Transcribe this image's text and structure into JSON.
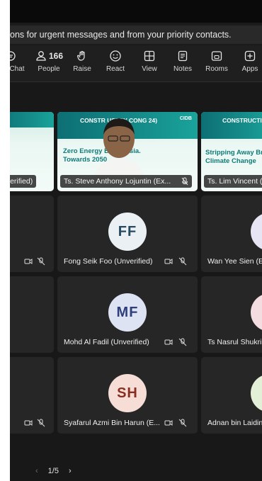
{
  "banner": {
    "text": "ons for urgent messages and from your priority contacts."
  },
  "toolbar": {
    "items": [
      {
        "label": "Chat",
        "icon": "chat-icon"
      },
      {
        "label": "People",
        "icon": "people-icon",
        "count": "166"
      },
      {
        "label": "Raise",
        "icon": "raise-hand-icon"
      },
      {
        "label": "React",
        "icon": "react-icon"
      },
      {
        "label": "View",
        "icon": "view-icon"
      },
      {
        "label": "Notes",
        "icon": "notes-icon"
      },
      {
        "label": "Rooms",
        "icon": "rooms-icon"
      },
      {
        "label": "Apps",
        "icon": "apps-icon"
      }
    ]
  },
  "stage": {
    "top_row": [
      {
        "name": "nverified)",
        "slide_text": "",
        "selected": true
      },
      {
        "name": "Ts. Steve Anthony Lojuntin (Ex...",
        "slide_title": "CONSTR USTRY CONG 24)",
        "slide_sub1": "Zero Energy B Malaysia.",
        "slide_sub2": "Towards 2050"
      },
      {
        "name": "Ts. Lim Vincent (",
        "slide_title": "CONSTRUCTI CONGRESS (C",
        "slide_sub1": "Stripping Away Bra",
        "slide_sub2": "Climate Change"
      }
    ],
    "grid": [
      {
        "name": "Fong Seik Foo (Unverified)",
        "initials": "FF",
        "avatar_bg": "#eaf0f4",
        "avatar_fg": "#274a63"
      },
      {
        "name": "Wan Yee Sien (Ex",
        "initials": "W",
        "avatar_bg": "#e7e5f3",
        "avatar_fg": "#3d3a6b"
      },
      {
        "name": "Mohd Al Fadil (Unverified)",
        "initials": "MF",
        "avatar_bg": "#dde3f3",
        "avatar_fg": "#2d3e7a"
      },
      {
        "name": "Ts Nasrul Shukri (",
        "initials": "",
        "avatar_bg": "#f3dde0",
        "avatar_fg": "#7a2d36"
      },
      {
        "name": "Syafarul Azmi Bin Harun (E...",
        "initials": "SH",
        "avatar_bg": "#f6ddd6",
        "avatar_fg": "#8a2f1f"
      },
      {
        "name": "Adnan bin Laidin",
        "initials": "",
        "avatar_bg": "#e4efd8",
        "avatar_fg": "#3f6b22"
      }
    ]
  },
  "pager": {
    "text": "1/5"
  },
  "colors": {
    "accent": "#7f85f5",
    "bg": "#181818"
  }
}
